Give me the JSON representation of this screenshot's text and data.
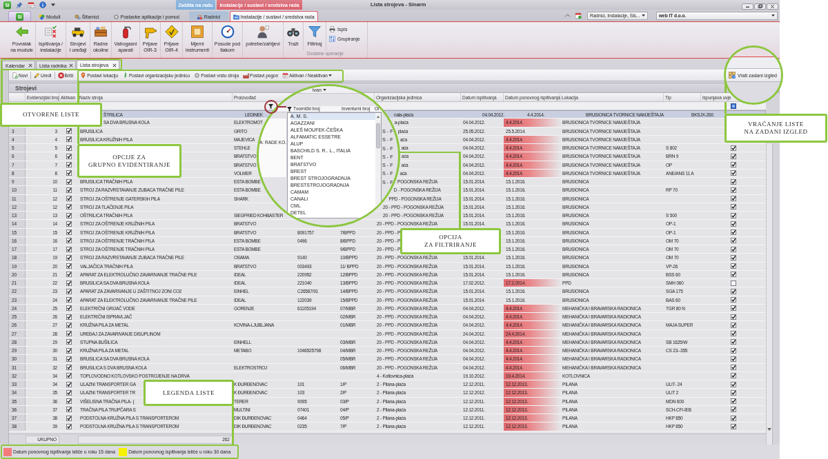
{
  "window": {
    "logo": "SI",
    "title": "Lista strojeva - Sinarm"
  },
  "ribbon": {
    "app_button": "SI",
    "tabs": [
      {
        "label": "Moduli",
        "selected": false
      },
      {
        "label": "Šifarnici",
        "selected": false
      },
      {
        "label": "Postavke aplikacije i pomoć",
        "selected": false
      }
    ],
    "context_groups": [
      {
        "label": "Zaštita na radu",
        "color": "#7fb0de",
        "tabs": [
          {
            "label": "Radnici",
            "selected": false
          }
        ]
      },
      {
        "label": "Instalacije / sustavi / sredstva rada",
        "color": "#de5f6c",
        "tabs": [
          {
            "label": "Instalacije / sustavi / sredstva rada",
            "selected": true
          }
        ]
      }
    ],
    "selectors": [
      "Radnici, Instalacije, Sis...",
      "web IT d.o.o."
    ],
    "groups": [
      {
        "buttons": [
          {
            "label": "Povratak\nna module"
          }
        ]
      },
      {
        "buttons": [
          {
            "label": "Ispitivanja /\ninstalacije"
          },
          {
            "label": "Strojevi\ni uređaji"
          },
          {
            "label": "Radne\nokoline"
          },
          {
            "label": "Vatrogasni\naparati"
          },
          {
            "label": "Prijave\nOIR-3"
          },
          {
            "label": "Prijave\nOIR-4"
          },
          {
            "label": "Mjerni\ninstrumenti"
          },
          {
            "label": "Posude pod\ntlakom"
          }
        ]
      },
      {
        "buttons": [
          {
            "label": "potrebe/zahtjevi"
          }
        ]
      },
      {
        "label": "Dodatne operacije",
        "buttons": [
          {
            "label": "Traži",
            "kind": "large"
          },
          {
            "label": "Filtriraj",
            "kind": "large"
          },
          {
            "label": "Ispis",
            "kind": "small"
          },
          {
            "label": "Grupiranje",
            "kind": "small"
          }
        ]
      }
    ]
  },
  "documents": [
    {
      "label": "Kalendar",
      "selected": false
    },
    {
      "label": "Lista radnika",
      "selected": false
    },
    {
      "label": "Lista strojeva",
      "selected": true
    }
  ],
  "toolbar": {
    "record_actions": [
      "Novi",
      "Uredi",
      "Briši"
    ],
    "group_actions": [
      {
        "label": "Postavi lokaciju",
        "kind": "button"
      },
      {
        "label": "Postavi organizacijsku jedinicu",
        "kind": "button"
      },
      {
        "label": "Postavi vrstu stroja",
        "kind": "button"
      },
      {
        "label": "Postavi pogon",
        "kind": "button"
      },
      {
        "label": "Aktivan / Neaktivan",
        "kind": "dropdown"
      }
    ],
    "reset_layout": "Vrati zadani izgled"
  },
  "grid": {
    "title": "Strojevi",
    "columns": {
      "record_no": "Evidencijski broj",
      "active": "Aktivan",
      "machine": "Naziv stroja",
      "manufacturer": "Proizvođač",
      "org_unit": "Organizacijska jedinica",
      "tested": "Datum ispitivanja",
      "retest": "Datum ponovnog ispitivanja",
      "location": "Lokacija",
      "type": "Tip",
      "meets": "Ispunjava uvje"
    },
    "rows": [
      {
        "machine": "ŠTRILICA",
        "manufacturer": "LEDINEK",
        "org_unit": "nala-plaća",
        "tested": "04.04.2012.",
        "retest": "4.4.2014.",
        "retest_due": false,
        "location": "BRUSIONICA TVORNICE NAMJEŠTAJA",
        "type": "BKSJX-260",
        "selected": true
      },
      {
        "machine": "SA DVA BRUSNA KOLA",
        "manufacturer": "ELEKTROMOT",
        "org_unit": "a-plaća",
        "tested": "04.04.2012.",
        "retest": "4.4.2014.",
        "retest_due": true,
        "location": "BRUSIONICA TVORNICE NAMJEŠTAJA",
        "selected": false
      },
      {
        "row_no": "3",
        "record_no": "3",
        "active": true,
        "machine": "BRUSILICA",
        "manufacturer": "GRITO",
        "org_unit": "plaća",
        "tested": "25.05.2012.",
        "retest": "25.5.2014.",
        "retest_due": false,
        "location": "BRUSIONICA TVORNICE NAMJEŠTAJA",
        "selected": false
      },
      {
        "row_no": "4",
        "record_no": "4",
        "active": true,
        "machine": "BRUSILICA KRUŽNIH PILA",
        "manufacturer": "MAJEVICA",
        "org_unit": "aća",
        "tested": "04.04.2012.",
        "retest": "4.4.2014.",
        "retest_due": true,
        "location": "BRUSIONICA TVORNICE NAMJEŠTAJA",
        "selected": false
      },
      {
        "row_no": "5",
        "record_no": "5",
        "active": true,
        "manufacturer": "STEHLE",
        "org_unit": "aća",
        "tested": "04.04.2012.",
        "retest": "4.4.2014.",
        "retest_due": true,
        "location": "BRUSIONICA TVORNICE NAMJEŠTAJA",
        "type": "S 802",
        "meets": true,
        "selected": false
      },
      {
        "row_no": "6",
        "record_no": "6",
        "active": true,
        "manufacturer": "BRATSTVO",
        "org_unit": "aća",
        "tested": "04.04.2012.",
        "retest": "4.4.2014.",
        "retest_due": true,
        "location": "BRUSIONICA TVORNICE NAMJEŠTAJA",
        "type": "BRN 9",
        "meets": true,
        "selected": false
      },
      {
        "row_no": "7",
        "record_no": "7",
        "active": true,
        "manufacturer": "BRATSTVO",
        "org_unit": "aća",
        "tested": "04.04.2012.",
        "retest": "4.4.2014.",
        "retest_due": true,
        "location": "BRUSIONICA TVORNICE NAMJEŠTAJA",
        "type": "OP",
        "meets": true,
        "selected": false
      },
      {
        "row_no": "8",
        "record_no": "8",
        "active": true,
        "manufacturer": "VOLMER",
        "org_unit": "aća",
        "tested": "04.04.2012.",
        "retest": "4.4.2014.",
        "retest_due": true,
        "location": "BRUSIONICA TVORNICE NAMJEŠTAJA",
        "type": "ANE/ANS 11 A",
        "meets": true,
        "selected": false
      },
      {
        "row_no": "9",
        "record_no": "10",
        "active": true,
        "machine": "BRUSILICA TRAČNIH PILA",
        "manufacturer": "ESTA BOMBE",
        "org_unit": "POGONSKA REŽIJA",
        "tested": "15.01.2014.",
        "retest": "15.1.2016.",
        "retest_due": false,
        "location": "BRUSIONICA",
        "meets": true,
        "selected": false
      },
      {
        "row_no": "10",
        "record_no": "11",
        "active": true,
        "machine": "STROJ ZA RAZVRSTAVANJE ZUBACA TRAČNE PILE",
        "manufacturer": "ESTA BOMBE",
        "org_unit": "D - POGONSKA REŽIJA",
        "tested": "15.01.2014.",
        "retest": "15.1.2016.",
        "retest_due": false,
        "location": "BRUSIONICA",
        "type": "RP 70",
        "meets": true,
        "selected": false
      },
      {
        "row_no": "11",
        "record_no": "12",
        "active": true,
        "machine": "STROJ ZA OŠTRENJE GATERSKIH PILA",
        "manufacturer": "SHARK",
        "org_unit": "PPD - POGONSKA REŽIJA",
        "tested": "15.01.2014.",
        "retest": "15.1.2016.",
        "retest_due": false,
        "location": "BRUSIONICA",
        "meets": true,
        "selected": false
      },
      {
        "row_no": "12",
        "record_no": "12",
        "active": true,
        "machine": "STROJ ZA TLAČENJE PILA",
        "org_unit": "20 - PPD - POGONSKA REŽIJA",
        "tested": "15.01.2014.",
        "retest": "15.1.2016.",
        "retest_due": false,
        "location": "BRUSIONICA",
        "meets": true,
        "selected": false
      },
      {
        "row_no": "13",
        "record_no": "13",
        "active": true,
        "machine": "OŠTRILICA TRAČNIH PILA",
        "manufacturer": "SIEGFRIED KOHBASTER",
        "org_unit": "20 - PPD - POGONSKA REŽIJA",
        "tested": "15.01.2014.",
        "retest": "15.1.2016.",
        "retest_due": false,
        "location": "BRUSIONICA",
        "type": "S 500",
        "meets": true,
        "selected": false
      },
      {
        "row_no": "14",
        "record_no": "14",
        "active": true,
        "machine": "STROJ ZA OŠTRENJE KRUŽNIH PILA",
        "manufacturer": "BRATSTVO",
        "org_unit": "20 - PPD - POGONSKA REŽIJA",
        "tested": "15.01.2014.",
        "retest": "15.1.2016.",
        "retest_due": false,
        "location": "BRUSIONICA",
        "type": "OP-1",
        "meets": true,
        "selected": false
      },
      {
        "row_no": "15",
        "record_no": "15",
        "active": true,
        "machine": "STROJ ZA OŠTRENJE KRUŽNIH PILA",
        "manufacturer": "BRATSTVO",
        "serial_no": "8091757",
        "inventory_no": "7/BPPD",
        "org_unit": "20 - PPD - P",
        "retest": "15.1.2016.",
        "retest_due": false,
        "location": "BRUSIONICA",
        "type": "OP-1",
        "meets": true,
        "selected": false
      },
      {
        "row_no": "16",
        "record_no": "16",
        "active": true,
        "machine": "STROJ ZA OŠTRENJE TRAČNIH PILA",
        "manufacturer": "ESTA BOMBE",
        "serial_no": "0496",
        "inventory_no": "8/BPPD",
        "org_unit": "20 - PPD - P",
        "retest": "15.1.2016.",
        "retest_due": false,
        "location": "BRUSIONICA",
        "type": "OM 70",
        "meets": true,
        "selected": false
      },
      {
        "row_no": "17",
        "record_no": "17",
        "active": true,
        "machine": "STROJ ZA OŠTRENJE TRAČNIH PILA",
        "manufacturer": "ESTA BOMBE",
        "inventory_no": "9/BPPD",
        "org_unit": "20 - PPD - P",
        "retest": "15.1.2016.",
        "retest_due": false,
        "location": "BRUSIONICA",
        "type": "OM 70",
        "meets": true,
        "selected": false
      },
      {
        "row_no": "18",
        "record_no": "19",
        "active": true,
        "machine": "STROJ ZA RAZVRSTAVANJE ZUBACA TRAČNE PILE",
        "manufacturer": "OSAMA",
        "serial_no": "9140",
        "inventory_no": "10/BPPD",
        "org_unit": "20 - PPD - POGONSKA REŽIJA",
        "tested": "15.01.2014.",
        "retest": "15.1.2016.",
        "retest_due": false,
        "location": "BRUSIONICA",
        "type": "OM 70",
        "meets": true,
        "selected": false
      },
      {
        "row_no": "19",
        "record_no": "20",
        "active": true,
        "machine": "VALJAČICA TRAČNIH PILA",
        "manufacturer": "BRATSTVO",
        "serial_no": "003493",
        "inventory_no": "11/ BPPD",
        "org_unit": "20 - PPD - POGONSKA REŽIJA",
        "tested": "15.01.2014.",
        "retest": "15.1.2016.",
        "retest_due": false,
        "location": "BRUSIONICA",
        "type": "VP-26",
        "meets": true,
        "selected": false
      },
      {
        "row_no": "20",
        "record_no": "21",
        "active": true,
        "machine": "APARAT ZA ELEKTROLUČNO ZAVARIVANJE TRAČNE PILE",
        "manufacturer": "IDEAL",
        "serial_no": "220952",
        "inventory_no": "12/BPPD",
        "org_unit": "20 - PPD - POGONSKA REŽIJA",
        "tested": "15.01.2014.",
        "retest": "15.1.2016.",
        "retest_due": false,
        "location": "BRUSIONICA",
        "type": "BSS 60",
        "meets": true,
        "selected": false
      },
      {
        "row_no": "21",
        "record_no": "22",
        "active": true,
        "machine": "BRUSILICA SA DVA BRUSNA KOLA",
        "manufacturer": "IDEAL",
        "serial_no": "221040",
        "inventory_no": "13/BPPD",
        "org_unit": "20 - PPD - POGONSKA REŽIJA",
        "tested": "17.02.2012.",
        "retest": "17.2.2014.",
        "retest_due": true,
        "location": "PPD",
        "type": "SMH 060",
        "meets": false,
        "selected": false
      },
      {
        "row_no": "22",
        "record_no": "23",
        "active": true,
        "machine": "APARAT ZA ZAVARIVANJE U ZAŠTITNOJ ZONI CO2",
        "manufacturer": "EINHEL",
        "serial_no": "C26587/91",
        "inventory_no": "14/BPPD",
        "org_unit": "20 - PPD - POGONSKA REŽIJA",
        "tested": "15.01.2014.",
        "retest": "15.1.2016.",
        "retest_due": false,
        "location": "BRUSIONICA",
        "type": "SGA 175",
        "meets": true,
        "selected": false
      },
      {
        "row_no": "23",
        "record_no": "24",
        "active": true,
        "machine": "APARAT ZA ELEKTROLUČNO ZAVARIVANJE TRAČNE PILE",
        "manufacturer": "IDEAL",
        "serial_no": "122039",
        "inventory_no": "15/BPPD",
        "org_unit": "20 - PPD - POGONSKA REŽIJA",
        "tested": "15.01.2014.",
        "retest": "15.1.2016.",
        "retest_due": false,
        "location": "BRUSIONICA",
        "type": "BAS 60",
        "meets": true,
        "selected": false
      },
      {
        "row_no": "24",
        "record_no": "25",
        "active": true,
        "machine": "ELEKTRIČNI GRIJAČ VODE",
        "manufacturer": "GORENJE",
        "serial_no": "61105194",
        "inventory_no": "07/MBR",
        "org_unit": "20 - PPD - POGONSKA REŽIJA",
        "tested": "04.04.2012.",
        "retest": "4.4.2014.",
        "retest_due": true,
        "location": "MEHANIČKA I BRAVARSKA RADIONICA",
        "type": "TGR 80 N",
        "meets": true,
        "selected": false
      },
      {
        "row_no": "25",
        "record_no": "26",
        "active": true,
        "machine": "ELEKTRIČNI ISPRAVLJAČ",
        "inventory_no": "02/MBR",
        "org_unit": "20 - PPD - POGONSKA REŽIJA",
        "tested": "04.04.2012.",
        "retest": "4.4.2014.",
        "retest_due": true,
        "location": "MEHANIČKA I BRAVARSKA RADIONICA",
        "meets": true,
        "selected": false
      },
      {
        "row_no": "26",
        "record_no": "27",
        "active": true,
        "machine": "KRUŽNA PILA ZA METAL",
        "manufacturer": "KOVINA-LJUBLJANA",
        "inventory_no": "01/MBR",
        "org_unit": "20 - PPD - POGONSKA REŽIJA",
        "tested": "04.04.2012.",
        "retest": "4.4.2014.",
        "retest_due": true,
        "location": "MEHANIČKA I BRAVARSKA RADIONICA",
        "type": "MAJA SUPER",
        "meets": true,
        "selected": false
      },
      {
        "row_no": "27",
        "record_no": "28",
        "active": true,
        "machine": "UREĐAJ ZA ZAVARIVANJE DISUPLINOM",
        "org_unit": "20 - PPD - POGONSKA REŽIJA",
        "tested": "24.04.2012.",
        "retest": "24.4.2014.",
        "retest_due": true,
        "location": "MEHANIČKA I BRAVARSKA RADIONICA",
        "meets": true,
        "selected": false
      },
      {
        "row_no": "28",
        "record_no": "29",
        "active": true,
        "machine": "STUPNA BUŠILICA",
        "manufacturer": "EINHELL",
        "inventory_no": "03/MBR",
        "org_unit": "20 - PPD - POGONSKA REŽIJA",
        "tested": "04.04.2012.",
        "retest": "4.4.2014.",
        "retest_due": true,
        "location": "MEHANIČKA I BRAVARSKA RADIONICA",
        "type": "SB 1625/W",
        "meets": true,
        "selected": false
      },
      {
        "row_no": "29",
        "record_no": "30",
        "active": true,
        "machine": "KRUŽNA PILA ZA METAL",
        "manufacturer": "METABO",
        "serial_no": "1046525798",
        "inventory_no": "04/MBR",
        "org_unit": "20 - PPD - POGONSKA REŽIJA",
        "tested": "04.04.2012.",
        "retest": "4.4.2014.",
        "retest_due": true,
        "location": "MEHANIČKA I BRAVARSKA RADIONICA",
        "type": "CS 23--355",
        "meets": true,
        "selected": false
      },
      {
        "row_no": "30",
        "record_no": "31",
        "active": true,
        "machine": "BRUSILICA SA DVA BRUSNA KOLA",
        "inventory_no": "05/MBR",
        "org_unit": "20 - PPD - POGONSKA REŽIJA",
        "tested": "04.04.2012.",
        "retest": "4.4.2014.",
        "retest_due": true,
        "location": "MEHANIČKA I BRAVARSKA RADIONICA",
        "meets": true,
        "selected": false
      },
      {
        "row_no": "31",
        "record_no": "32",
        "active": true,
        "machine": "BRUSILICA S DVA BRUSNA KOLA",
        "manufacturer": "ELEKTROSTROJ",
        "inventory_no": "06/MBR",
        "org_unit": "20 - PPD - POGONSKA REŽIJA",
        "tested": "04.04.2012.",
        "retest": "4.4.2014.",
        "retest_due": true,
        "location": "MEHANIČKA I BRAVARSKA RADIONICA",
        "meets": true,
        "selected": false
      },
      {
        "row_no": "32",
        "record_no": "34",
        "active": true,
        "machine": "TOPLOVODNO KOTLOVSKO POSTROJENJE NA DRVA",
        "org_unit": "4 - Kotlovnica-plaća",
        "tested": "19.10.2012.",
        "retest": "19.4.2014.",
        "retest_due": true,
        "location": "KOTLOVNICA",
        "meets": true,
        "selected": false
      },
      {
        "row_no": "33",
        "record_no": "34",
        "active": true,
        "machine": "ULAZNI TRANSPORTER GA",
        "manufacturer": "K ĐURĐENOVAC",
        "serial_no": "101",
        "inventory_no": "1/P",
        "org_unit": "2 - Pilana-plaća",
        "tested": "12.12.2011.",
        "retest": "12.12.2013.",
        "retest_due": true,
        "location": "PILANA",
        "type": "ULIT- 24",
        "meets": true,
        "selected": false
      },
      {
        "row_no": "34",
        "record_no": "35",
        "active": true,
        "machine": "ULAZNI TRANSPORTER TR",
        "manufacturer": "K ĐURĐENOVAC",
        "serial_no": "103",
        "inventory_no": "2/P",
        "org_unit": "2 - Pilana-plaća",
        "tested": "12.12.2012.",
        "retest": "12.12.2013.",
        "retest_due": true,
        "location": "PILANA",
        "type": "ULIT 2",
        "meets": true,
        "selected": false
      },
      {
        "row_no": "35",
        "record_no": "36",
        "active": true,
        "machine": "VIŠELISNA TRAČNA PILA- (",
        "manufacturer": "TERER",
        "serial_no": "9095",
        "inventory_no": "03/P",
        "org_unit": "2 - Pilana-plaća",
        "tested": "12.12.2011.",
        "retest": "12.12.2013.",
        "retest_due": true,
        "location": "PILANA",
        "type": "MDN 600",
        "meets": true,
        "selected": false
      },
      {
        "row_no": "36",
        "record_no": "37",
        "active": true,
        "machine": "TRAČNA PILA TRUPČARA S",
        "manufacturer": "MULTINI",
        "serial_no": "07401",
        "inventory_no": "04/P",
        "org_unit": "2 - Pilana-plaća",
        "tested": "12.12.2011.",
        "retest": "12.12.2013.",
        "retest_due": true,
        "location": "PILANA",
        "type": "SCH-CFI-IEB",
        "meets": true,
        "selected": false
      },
      {
        "row_no": "37",
        "record_no": "38",
        "active": true,
        "machine": "PODSTOLNA KRUŽNA PILA S TRANSPORTEROM",
        "manufacturer": "DIK ĐURĐENOVAC",
        "serial_no": "0464",
        "inventory_no": "05/P",
        "org_unit": "2 - Pilana-plaća",
        "tested": "12.12.2011.",
        "retest": "12.12.2013.",
        "retest_due": true,
        "location": "PILANA",
        "type": "HKP 850",
        "meets": true,
        "selected": false
      },
      {
        "row_no": "38",
        "record_no": "39",
        "active": true,
        "machine": "PODSTOLNA KRUŽNA PILA S TRANSPORTEROM",
        "manufacturer": "DIK ĐURĐENOVAC",
        "serial_no": "0235",
        "inventory_no": "7/P",
        "org_unit": "2 - Pilana-plaća",
        "tested": "12.12.2011.",
        "retest": "12.12.2013.",
        "retest_due": true,
        "location": "PILANA",
        "type": "HKP 850",
        "meets": true,
        "selected": false
      }
    ],
    "footer": {
      "label": "UKUPNO",
      "total": "262"
    }
  },
  "legend": [
    {
      "label": "Datum ponovnog ispitivanja ističe u roku 15 dana",
      "color": "#f47c7c"
    },
    {
      "label": "Datum ponovnog ispitivanja ističe u roku 30 dana",
      "color": "#f6f200"
    }
  ],
  "annotations": {
    "callouts": [
      {
        "text": "OTVORENE LISTE"
      },
      {
        "text": "OPCIJE ZA\nGRUPNO EVIDENTIRANJE"
      },
      {
        "text": "OPCIJA\nZA FILTRIRANJE"
      },
      {
        "text": "LEGENDA LISTE"
      },
      {
        "text": "VRAĆANJE LISTE\nNA ZADANI IZGLED"
      }
    ],
    "filter_zoom": {
      "toolbar_fragment": "ivan",
      "columns": [
        "Tvornički broj",
        "Inventurni broj",
        "Or"
      ],
      "cell_fragment": "A: RADE KO.",
      "options": [
        {
          "label": "A. M. S.",
          "selected": true
        },
        {
          "label": "AGAZZANI",
          "selected": false
        },
        {
          "label": "ALEŠ MOUFEK-ČEŠKA",
          "selected": false
        },
        {
          "label": "ALFAMATIC ESSETRE",
          "selected": false
        },
        {
          "label": "ALUP",
          "selected": false
        },
        {
          "label": "BASCHILD S. R.. L., ITALIA",
          "selected": false
        },
        {
          "label": "BENT",
          "selected": false
        },
        {
          "label": "BRATSTVO",
          "selected": false
        },
        {
          "label": "BREST",
          "selected": false
        },
        {
          "label": "BREST STROJOGRADNJA",
          "selected": false
        },
        {
          "label": "BRESTSTROJOGRADNJA",
          "selected": false
        },
        {
          "label": "CAMAM",
          "selected": false
        },
        {
          "label": "CANALI",
          "selected": false
        },
        {
          "label": "CML",
          "selected": false
        },
        {
          "label": "DETEL",
          "selected": false
        }
      ],
      "side_fragments": [
        "S - F",
        "S - F",
        "S - F",
        "S - F",
        "S - F",
        "S - F",
        "S - F"
      ]
    }
  }
}
